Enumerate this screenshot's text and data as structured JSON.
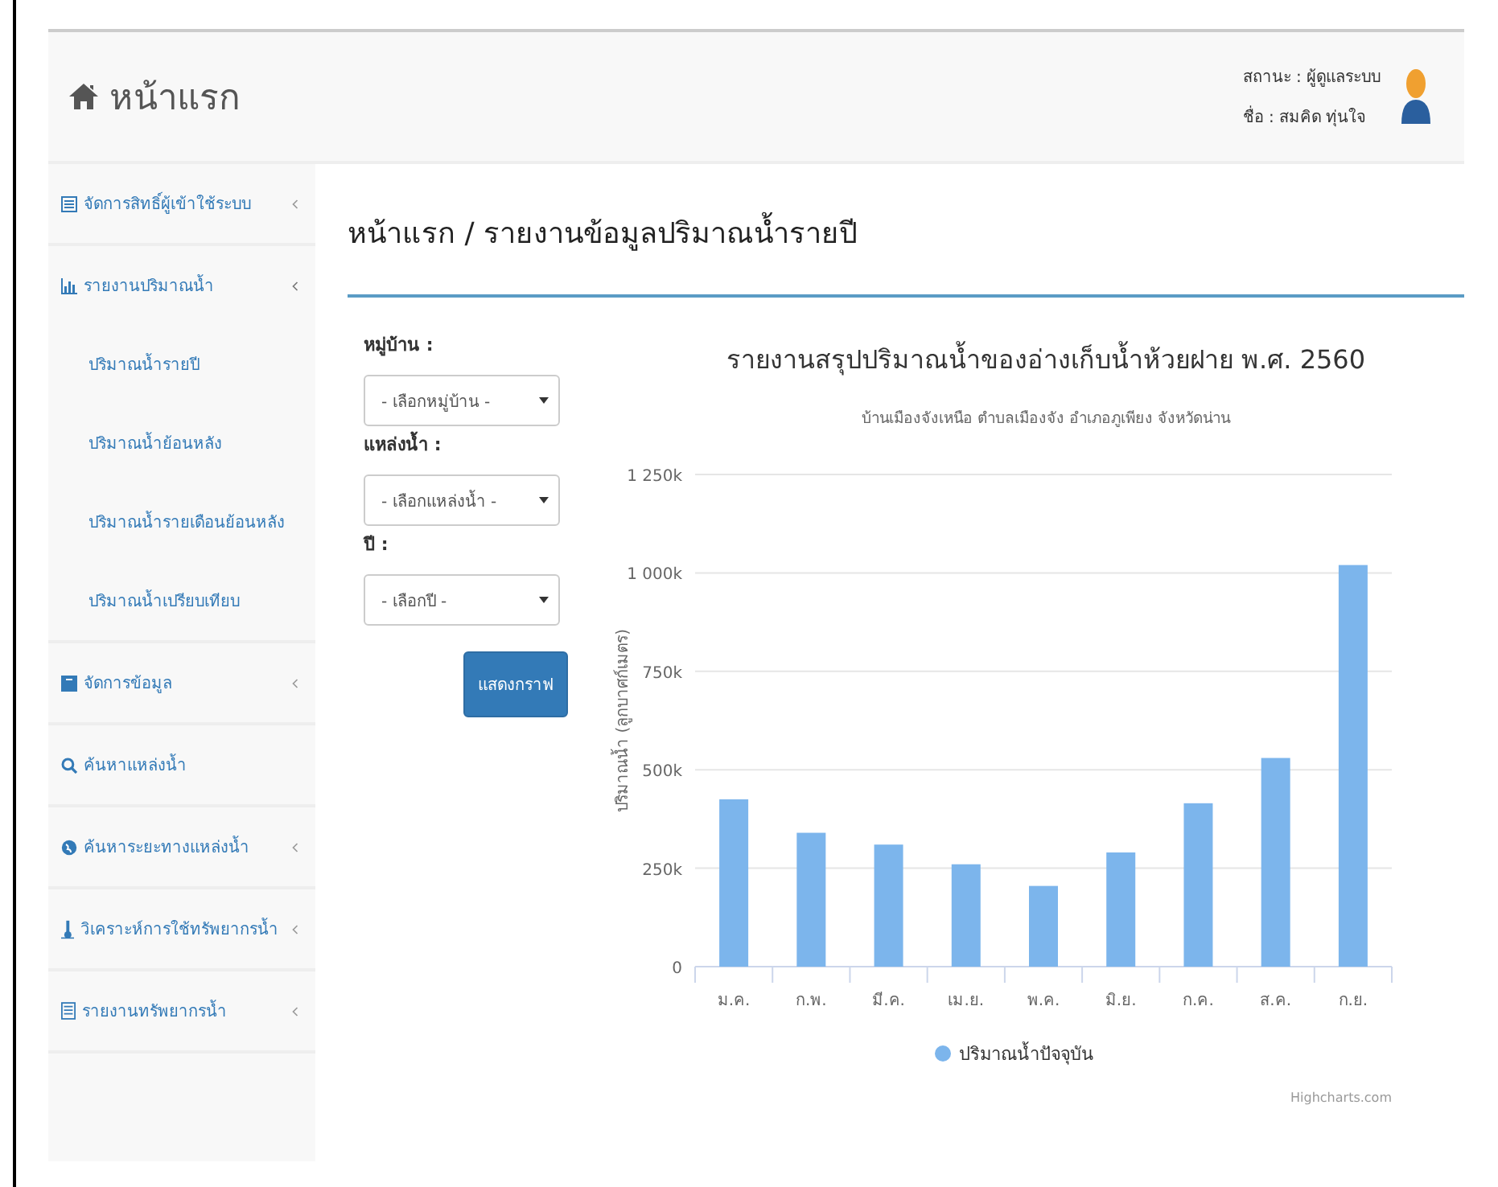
{
  "header": {
    "title": "หน้าแรก",
    "status": "สถานะ : ผู้ดูแลระบบ",
    "user": "ชื่อ : สมคิด ทุ่นใจ"
  },
  "sidebar": {
    "items": [
      {
        "label": "จัดการสิทธิ์ผู้เข้าใช้ระบบ",
        "kind": "list",
        "expanded": false
      },
      {
        "label": "รายงานปริมาณน้ำ",
        "kind": "chart",
        "expanded": true,
        "children": [
          {
            "label": "ปริมาณน้ำรายปี"
          },
          {
            "label": "ปริมาณน้ำย้อนหลัง"
          },
          {
            "label": "ปริมาณน้ำรายเดือนย้อนหลัง"
          },
          {
            "label": "ปริมาณน้ำเปรียบเทียบ"
          }
        ]
      },
      {
        "label": "จัดการข้อมูล",
        "kind": "archive",
        "expanded": false
      },
      {
        "label": "ค้นหาแหล่งน้ำ",
        "kind": "search"
      },
      {
        "label": "ค้นหาระยะทางแหล่งน้ำ",
        "kind": "globe",
        "expanded": false
      },
      {
        "label": "วิเคราะห์การใช้ทรัพยากรน้ำ",
        "kind": "thermometer",
        "expanded": false
      },
      {
        "label": "รายงานทรัพยากรน้ำ",
        "kind": "doc",
        "expanded": false
      }
    ]
  },
  "breadcrumb": "หน้าแรก  / รายงานข้อมูลปริมาณน้ำรายปี",
  "form": {
    "fields": [
      {
        "label": "หมู่บ้าน :",
        "placeholder": "- เลือกหมู่บ้าน -"
      },
      {
        "label": "แหล่งน้ำ :",
        "placeholder": "- เลือกแหล่งน้ำ -"
      },
      {
        "label": "ปี :",
        "placeholder": "- เลือกปี -"
      }
    ],
    "button": "แสดงกราฟ"
  },
  "chart": {
    "chart_data": {
      "type": "bar",
      "title": "รายงานสรุปปริมาณน้ำของอ่างเก็บน้ำห้วยฝาย พ.ศ. 2560",
      "subtitle": "บ้านเมืองจังเหนือ ตำบลเมืองจัง อำเภอภูเพียง จังหวัดน่าน",
      "ylabel": "ปริมาณน้ำ (ลูกบาศก์เมตร)",
      "categories": [
        "ม.ค.",
        "ก.พ.",
        "มี.ค.",
        "เม.ย.",
        "พ.ค.",
        "มิ.ย.",
        "ก.ค.",
        "ส.ค.",
        "ก.ย."
      ],
      "series": [
        {
          "name": "ปริมาณน้ำปัจจุบัน",
          "color": "#7cb5ec",
          "values": [
            425000,
            340000,
            310000,
            260000,
            205000,
            290000,
            415000,
            530000,
            1020000
          ]
        }
      ],
      "ylim": [
        0,
        1250000
      ],
      "grid": true,
      "yticks": [
        {
          "value": 0,
          "label": "0"
        },
        {
          "value": 250000,
          "label": "250k"
        },
        {
          "value": 500000,
          "label": "500k"
        },
        {
          "value": 750000,
          "label": "750k"
        },
        {
          "value": 1000000,
          "label": "1 000k"
        },
        {
          "value": 1250000,
          "label": "1 250k"
        }
      ]
    },
    "credits": "Highcharts.com"
  }
}
